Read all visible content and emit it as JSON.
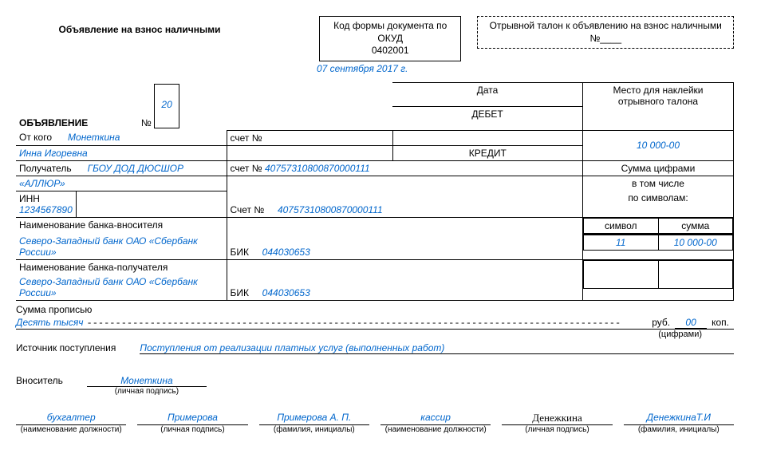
{
  "header": {
    "title": "Объявление на взнос наличными",
    "okud_label": "Код формы документа по ОКУД",
    "okud_value": "0402001",
    "tearoff_text": "Отрывной талон к объявлению на взнос наличными №____",
    "date_value": "07 сентября 2017 г."
  },
  "obj": {
    "title": "ОБЪЯВЛЕНИЕ",
    "num_label": "№",
    "num_value": "20",
    "date_label": "Дата",
    "sticker_line1": "Место для наклейки",
    "sticker_line2": "отрывного талона"
  },
  "debet_label": "ДЕБЕТ",
  "kredit_label": "КРЕДИТ",
  "from": {
    "label": "От кого",
    "name_line1": "Монеткина",
    "name_line2": "Инна Игоревна",
    "schet_label": "счет №",
    "amount_blue": "10 000-00"
  },
  "recipient": {
    "label": "Получатель",
    "name_line1": "ГБОУ ДОД ДЮСШОР",
    "name_line2": "«АЛЛЮР»",
    "schet_label": "счет №",
    "schet_value": "40757310800870000111",
    "summa_label": "Сумма цифрами",
    "vtom_line1": "в том числе",
    "vtom_line2": "по символам:"
  },
  "inn": {
    "label": "ИНН",
    "value": "1234567890",
    "schet_label": "Счет №",
    "schet_value": "40757310800870000111"
  },
  "bank_in": {
    "label": "Наименование банка-вносителя",
    "value": "Северо-Западный банк ОАО «Сбербанк России»",
    "bik_label": "БИК",
    "bik_value": "044030653",
    "symbol_label": "символ",
    "symbol_value": "11",
    "summa_label": "сумма",
    "summa_value": "10 000-00"
  },
  "bank_out": {
    "label": "Наименование банка-получателя",
    "value": "Северо-Западный банк ОАО «Сбербанк России»",
    "bik_label": "БИК",
    "bik_value": "044030653"
  },
  "summa_words": {
    "label": "Сумма прописью",
    "value": "Десять тысяч",
    "rub": "руб.",
    "kop_value": "00",
    "kop": "коп.",
    "cifr": "(цифрами)"
  },
  "source": {
    "label": "Источник поступления",
    "value": "Поступления от реализации платных услуг (выполненных работ)"
  },
  "depositor": {
    "label": "Вноситель",
    "value": "Монеткина",
    "sub": "(личная подпись)"
  },
  "sig": {
    "col1_value": "бухгалтер",
    "col1_sub": "(наименование должности)",
    "col2_value": "Примерова",
    "col2_sub": "(личная подпись)",
    "col3_value": "Примерова А. П.",
    "col3_sub": "(фамилия, инициалы)",
    "col4_value": "кассир",
    "col4_sub": "(наименование должности)",
    "col5_value": "Денежкина",
    "col5_sub": "(личная подпись)",
    "col6_value": "ДенежкинаТ.И",
    "col6_sub": "(фамилия, инициалы)"
  }
}
